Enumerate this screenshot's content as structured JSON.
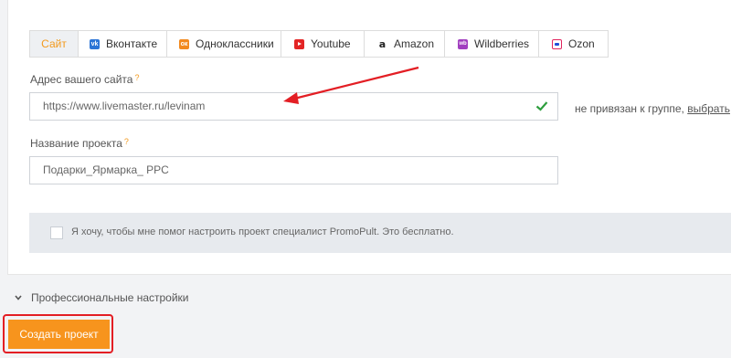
{
  "tabs": [
    {
      "label": "Сайт",
      "icon": "none",
      "active": true
    },
    {
      "label": "Вконтакте",
      "icon": "vk-icon"
    },
    {
      "label": "Одноклассники",
      "icon": "odnoklassniki-icon"
    },
    {
      "label": "Youtube",
      "icon": "youtube-icon"
    },
    {
      "label": "Amazon",
      "icon": "amazon-icon"
    },
    {
      "label": "Wildberries",
      "icon": "wildberries-icon"
    },
    {
      "label": "Ozon",
      "icon": "ozon-icon"
    }
  ],
  "site": {
    "label": "Адрес вашего сайта",
    "help": "?",
    "value": "https://www.livemaster.ru/levinam",
    "valid": true,
    "note": "не привязан к группе, ",
    "note_link": "выбрать"
  },
  "project": {
    "label": "Название проекта",
    "help": "?",
    "value": "Подарки_Ярмарка_ PPC"
  },
  "consent": {
    "checked": false,
    "text": "Я хочу, чтобы мне помог настроить проект специалист PromoPult. Это бесплатно."
  },
  "pro_settings": {
    "label": "Профессиональные настройки"
  },
  "create_button": {
    "label": "Создать проект"
  },
  "colors": {
    "accent": "#f7941d",
    "annotation": "#e31e24",
    "valid": "#2e9e3e"
  }
}
